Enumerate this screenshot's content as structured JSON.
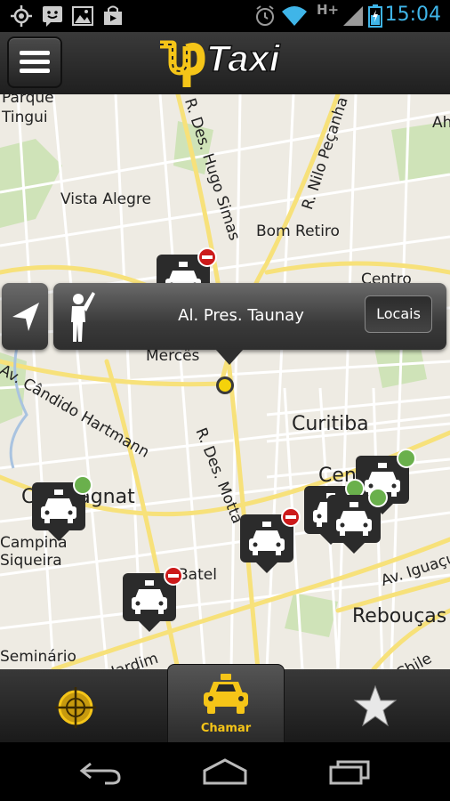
{
  "status_bar": {
    "time": "15:04",
    "icons": [
      "gps-icon",
      "messenger-icon",
      "gallery-icon",
      "store-icon",
      "alarm-icon",
      "wifi-icon",
      "network-hplus-icon",
      "signal-icon",
      "battery-icon"
    ],
    "network_label": "H+"
  },
  "action_bar": {
    "logo_text_up": "up",
    "logo_text_taxi": "Taxi",
    "menu_icon": "menu-icon"
  },
  "map": {
    "labels": {
      "parque_tingui_1": "Parque",
      "parque_tingui_2": "Tingui",
      "vista_alegre": "Vista Alegre",
      "hugo_simas": "R. Des. Hugo Simas",
      "nilo_pecanha": "R. Nilo Peçanha",
      "bom_retiro": "Bom Retiro",
      "centro": "Centro",
      "ah": "Ah",
      "merces": "Mercês",
      "candido_hartmann": "Av. Cândido Hartmann",
      "curitiba": "Curitiba",
      "des_motta": "R. Des. Motta",
      "campina": "Campina",
      "siqueira": "Siqueira",
      "bigorrilho": "Campagnat",
      "batel": "Batel",
      "reboucas": "Rebouças",
      "av_iguacu": "Av. Iguaçu",
      "chile": "Chile",
      "seminario": "Seminário",
      "jardim": "Av. Jardim",
      "centro2": "Cen"
    },
    "markers": [
      {
        "id": "taxi-1",
        "status": "busy"
      },
      {
        "id": "taxi-2",
        "status": "available"
      },
      {
        "id": "taxi-3",
        "status": "busy"
      },
      {
        "id": "taxi-4",
        "status": "busy"
      },
      {
        "id": "taxi-5",
        "status": "available"
      },
      {
        "id": "taxi-6",
        "status": "available"
      },
      {
        "id": "taxi-7",
        "status": "available"
      }
    ],
    "colors": {
      "busy": "#cc1a1a",
      "available": "#6ab04c",
      "user_location": "#f5d20a"
    }
  },
  "address_bubble": {
    "address": "Al. Pres. Taunay",
    "locais_label": "Locais"
  },
  "tab_bar": {
    "tabs": [
      {
        "name": "locate",
        "icon": "crosshair-icon",
        "label": ""
      },
      {
        "name": "chamar",
        "icon": "taxi-icon",
        "label": "Chamar"
      },
      {
        "name": "favorites",
        "icon": "star-icon",
        "label": ""
      }
    ],
    "accent": "#f5c518"
  },
  "nav_bar": {
    "icons": [
      "back-icon",
      "home-icon",
      "recent-apps-icon"
    ]
  }
}
